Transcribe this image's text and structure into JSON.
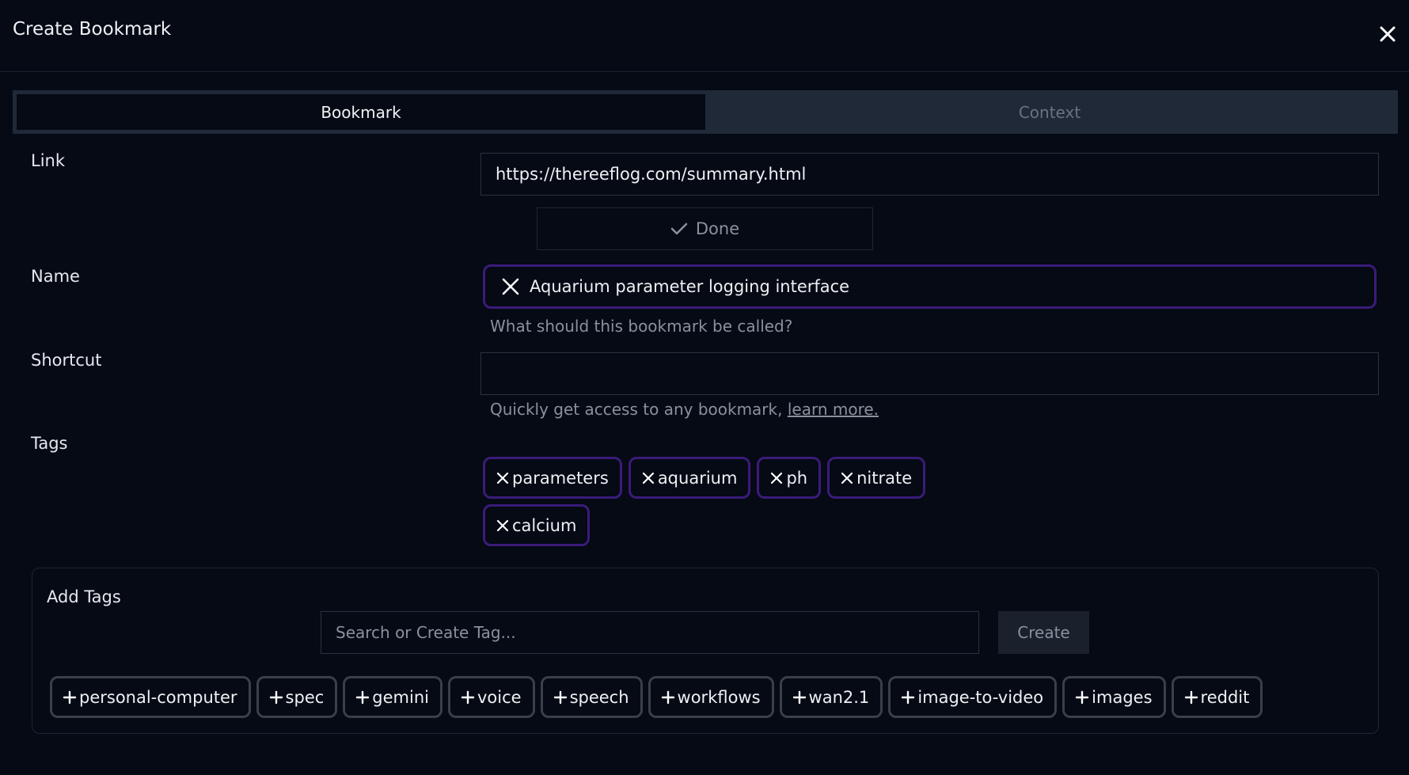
{
  "dialog": {
    "title": "Create Bookmark",
    "close_icon": "close-icon"
  },
  "tabs": [
    {
      "label": "Bookmark",
      "active": true
    },
    {
      "label": "Context",
      "active": false
    }
  ],
  "form": {
    "link": {
      "label": "Link",
      "value": "https://thereeflog.com/summary.html"
    },
    "done_button": {
      "label": "Done",
      "icon": "check-icon"
    },
    "name": {
      "label": "Name",
      "value": "Aquarium parameter logging interface",
      "hint": "What should this bookmark be called?"
    },
    "shortcut": {
      "label": "Shortcut",
      "value": "",
      "hint_text": "Quickly get access to any bookmark, ",
      "hint_link": "learn more."
    },
    "tags": {
      "label": "Tags",
      "items": [
        "parameters",
        "aquarium",
        "ph",
        "nitrate",
        "calcium"
      ]
    }
  },
  "add_tags": {
    "title": "Add Tags",
    "search_placeholder": "Search or Create Tag...",
    "create_label": "Create",
    "suggestions": [
      "personal-computer",
      "spec",
      "gemini",
      "voice",
      "speech",
      "workflows",
      "wan2.1",
      "image-to-video",
      "images",
      "reddit"
    ]
  },
  "colors": {
    "background": "#050a14",
    "tag_border": "#3b1b7a",
    "suggestion_border": "#3a3f4a",
    "tab_bar": "#1f2937"
  }
}
